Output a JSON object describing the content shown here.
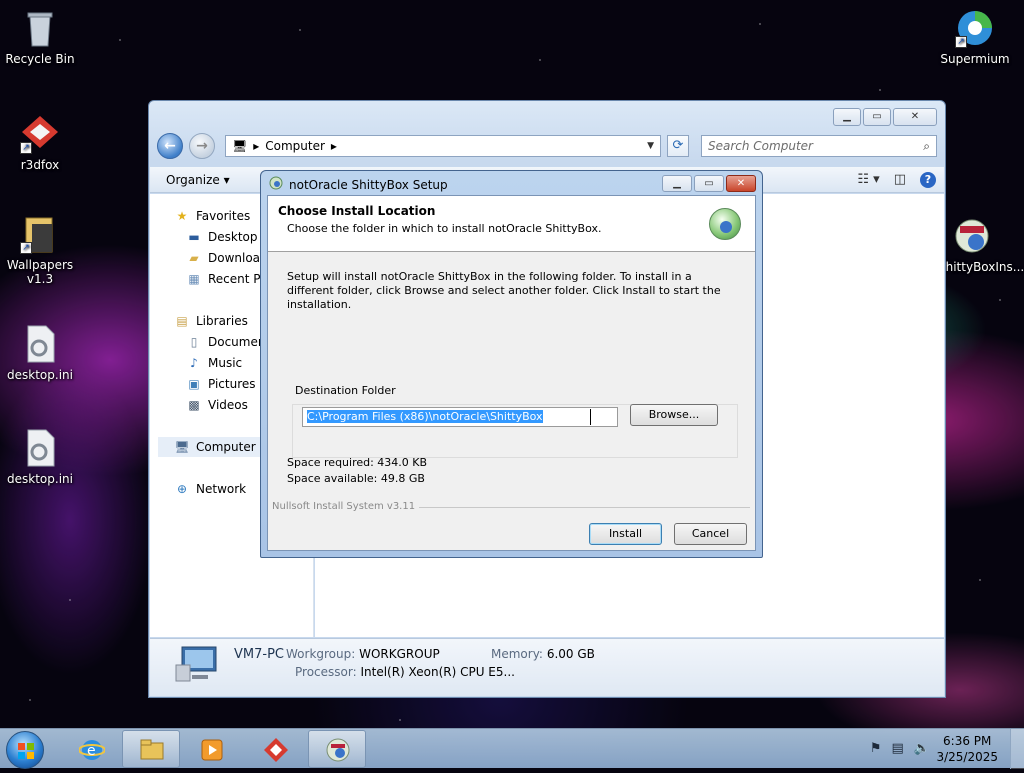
{
  "desktop": {
    "icons": [
      {
        "label": "Recycle Bin"
      },
      {
        "label": "r3dfox"
      },
      {
        "label": "Wallpapers v1.3"
      },
      {
        "label": "desktop.ini"
      },
      {
        "label": "desktop.ini"
      },
      {
        "label": "Supermium"
      },
      {
        "label": "ShittyBoxIns..."
      }
    ]
  },
  "explorer": {
    "breadcrumb": {
      "root_sep": "▸",
      "location": "Computer",
      "trail_sep": "▸"
    },
    "search_placeholder": "Search Computer",
    "toolbar": {
      "organize": "Organize ▾"
    },
    "nav": {
      "favorites": "Favorites",
      "desktop": "Desktop",
      "downloads": "Download",
      "recent": "Recent Pla",
      "libraries": "Libraries",
      "documents": "Document",
      "music": "Music",
      "pictures": "Pictures",
      "videos": "Videos",
      "computer": "Computer",
      "network": "Network"
    },
    "details": {
      "pc_name": "VM7-PC",
      "workgroup_label": "Workgroup:",
      "workgroup_value": "WORKGROUP",
      "memory_label": "Memory:",
      "memory_value": "6.00 GB",
      "processor_label": "Processor:",
      "processor_value": "Intel(R) Xeon(R) CPU E5..."
    }
  },
  "setup": {
    "title": "notOracle ShittyBox Setup",
    "header_title": "Choose Install Location",
    "header_sub": "Choose the folder in which to install notOracle ShittyBox.",
    "instructions": "Setup will install notOracle ShittyBox in the following folder. To install in a different folder, click Browse and select another folder. Click Install to start the installation.",
    "dest_label": "Destination Folder",
    "dest_path": "C:\\Program Files (x86)\\notOracle\\ShittyBox",
    "browse": "Browse...",
    "space_required": "Space required: 434.0 KB",
    "space_available": "Space available: 49.8 GB",
    "branding": "Nullsoft Install System v3.11",
    "install": "Install",
    "cancel": "Cancel"
  },
  "taskbar": {
    "time": "6:36 PM",
    "date": "3/25/2025"
  },
  "colors": {
    "selection": "#3399ff",
    "window_frame": "#c8d9ee",
    "taskbar": "#a6bfdc"
  }
}
